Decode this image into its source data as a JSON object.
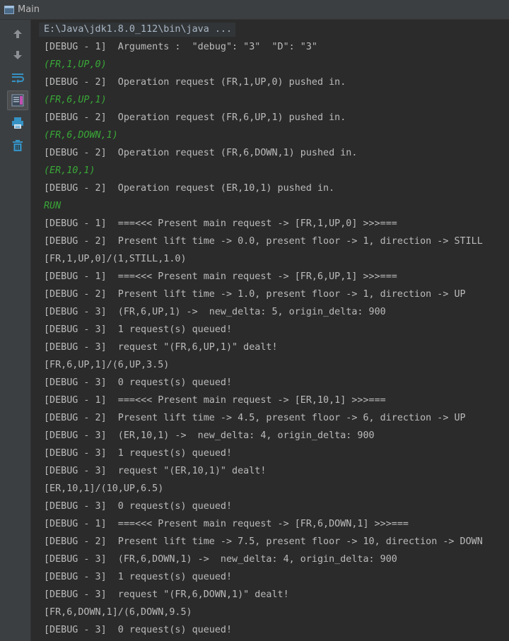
{
  "window": {
    "title": "Main"
  },
  "toolbar": {
    "buttons": [
      {
        "name": "up-arrow-icon"
      },
      {
        "name": "down-arrow-icon"
      },
      {
        "name": "soft-wrap-icon"
      },
      {
        "name": "scroll-to-end-icon"
      },
      {
        "name": "print-icon"
      },
      {
        "name": "trash-icon"
      }
    ]
  },
  "console": {
    "lines": [
      {
        "text": "E:\\Java\\jdk1.8.0_112\\bin\\java ...",
        "kind": "cmd"
      },
      {
        "text": "[DEBUG - 1]  Arguments :  \"debug\": \"3\"  \"D\": \"3\"",
        "kind": "out"
      },
      {
        "text": "(FR,1,UP,0)",
        "kind": "input"
      },
      {
        "text": "[DEBUG - 2]  Operation request (FR,1,UP,0) pushed in.",
        "kind": "out"
      },
      {
        "text": "(FR,6,UP,1)",
        "kind": "input"
      },
      {
        "text": "[DEBUG - 2]  Operation request (FR,6,UP,1) pushed in.",
        "kind": "out"
      },
      {
        "text": "(FR,6,DOWN,1)",
        "kind": "input"
      },
      {
        "text": "[DEBUG - 2]  Operation request (FR,6,DOWN,1) pushed in.",
        "kind": "out"
      },
      {
        "text": "(ER,10,1)",
        "kind": "input"
      },
      {
        "text": "[DEBUG - 2]  Operation request (ER,10,1) pushed in.",
        "kind": "out"
      },
      {
        "text": "RUN",
        "kind": "input"
      },
      {
        "text": "[DEBUG - 1]  ===<<< Present main request -> [FR,1,UP,0] >>>===",
        "kind": "out"
      },
      {
        "text": "[DEBUG - 2]  Present lift time -> 0.0, present floor -> 1, direction -> STILL",
        "kind": "out"
      },
      {
        "text": "[FR,1,UP,0]/(1,STILL,1.0)",
        "kind": "out"
      },
      {
        "text": "[DEBUG - 1]  ===<<< Present main request -> [FR,6,UP,1] >>>===",
        "kind": "out"
      },
      {
        "text": "[DEBUG - 2]  Present lift time -> 1.0, present floor -> 1, direction -> UP",
        "kind": "out"
      },
      {
        "text": "[DEBUG - 3]  (FR,6,UP,1) ->  new_delta: 5, origin_delta: 900",
        "kind": "out"
      },
      {
        "text": "[DEBUG - 3]  1 request(s) queued!",
        "kind": "out"
      },
      {
        "text": "[DEBUG - 3]  request \"(FR,6,UP,1)\" dealt!",
        "kind": "out"
      },
      {
        "text": "[FR,6,UP,1]/(6,UP,3.5)",
        "kind": "out"
      },
      {
        "text": "[DEBUG - 3]  0 request(s) queued!",
        "kind": "out"
      },
      {
        "text": "[DEBUG - 1]  ===<<< Present main request -> [ER,10,1] >>>===",
        "kind": "out"
      },
      {
        "text": "[DEBUG - 2]  Present lift time -> 4.5, present floor -> 6, direction -> UP",
        "kind": "out"
      },
      {
        "text": "[DEBUG - 3]  (ER,10,1) ->  new_delta: 4, origin_delta: 900",
        "kind": "out"
      },
      {
        "text": "[DEBUG - 3]  1 request(s) queued!",
        "kind": "out"
      },
      {
        "text": "[DEBUG - 3]  request \"(ER,10,1)\" dealt!",
        "kind": "out"
      },
      {
        "text": "[ER,10,1]/(10,UP,6.5)",
        "kind": "out"
      },
      {
        "text": "[DEBUG - 3]  0 request(s) queued!",
        "kind": "out"
      },
      {
        "text": "[DEBUG - 1]  ===<<< Present main request -> [FR,6,DOWN,1] >>>===",
        "kind": "out"
      },
      {
        "text": "[DEBUG - 2]  Present lift time -> 7.5, present floor -> 10, direction -> DOWN",
        "kind": "out"
      },
      {
        "text": "[DEBUG - 3]  (FR,6,DOWN,1) ->  new_delta: 4, origin_delta: 900",
        "kind": "out"
      },
      {
        "text": "[DEBUG - 3]  1 request(s) queued!",
        "kind": "out"
      },
      {
        "text": "[DEBUG - 3]  request \"(FR,6,DOWN,1)\" dealt!",
        "kind": "out"
      },
      {
        "text": "[FR,6,DOWN,1]/(6,DOWN,9.5)",
        "kind": "out"
      },
      {
        "text": "[DEBUG - 3]  0 request(s) queued!",
        "kind": "out"
      }
    ]
  },
  "colors": {
    "background": "#2b2b2b",
    "panel": "#3c3f41",
    "output_text": "#bbbbbb",
    "input_text": "#39a737",
    "icon_blue": "#3592c4",
    "icon_gray": "#8c8f93"
  }
}
